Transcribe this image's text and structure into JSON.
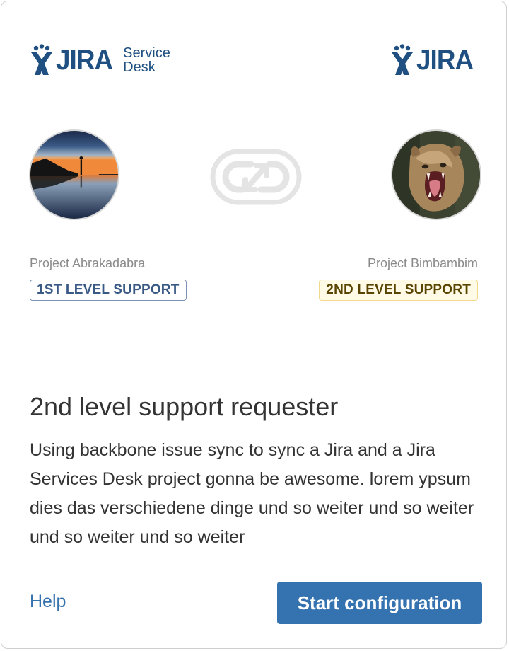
{
  "logos": {
    "left": {
      "wordmark": "JIRA",
      "sub_line1": "Service",
      "sub_line2": "Desk",
      "icon": "jira-logo-icon"
    },
    "right": {
      "wordmark": "JIRA",
      "icon": "jira-logo-icon"
    }
  },
  "sync": {
    "icon": "sync-link-icon"
  },
  "projects": {
    "left": {
      "name": "Project Abrakadabra",
      "badge": "1ST LEVEL SUPPORT"
    },
    "right": {
      "name": "Project Bimbambim",
      "badge": "2ND LEVEL SUPPORT"
    }
  },
  "content": {
    "title": "2nd level support requester",
    "description": "Using backbone issue sync to sync a Jira and a Jira Services Desk project gonna be awesome. lorem ypsum dies das verschiedene dinge und so weiter und so weiter und so weiter und so weiter"
  },
  "footer": {
    "help_label": "Help",
    "start_label": "Start configuration"
  },
  "colors": {
    "brand": "#205081",
    "primary_button": "#3572b0",
    "badge1_border": "#7d93b0",
    "badge2_border": "#f1d98a"
  }
}
